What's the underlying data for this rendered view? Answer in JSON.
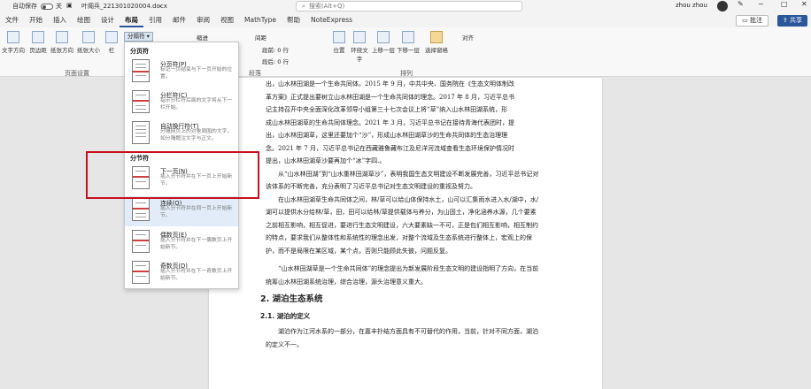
{
  "titlebar": {
    "autosave_label": "自动保存",
    "autosave_state": "关",
    "filename": "叶阁兵_221301020004.docx",
    "search_placeholder": "搜索(Alt+Q)",
    "user": "zhou zhou"
  },
  "menubar": {
    "items": [
      "文件",
      "开始",
      "插入",
      "绘图",
      "设计",
      "布局",
      "引用",
      "邮件",
      "审阅",
      "视图",
      "MathType",
      "帮助",
      "NoteExpress"
    ],
    "active": "布局",
    "comment_label": "批注",
    "share_label": "共享"
  },
  "ribbon": {
    "buttons": [
      "文字方向",
      "页边距",
      "纸张方向",
      "纸张大小",
      "栏"
    ],
    "breaks_button": "分隔符",
    "indent_label": "缩进",
    "spacing_label": "间距",
    "spacing_before": "段前: 0 行",
    "spacing_after": "段后: 0 行",
    "page_setup_label": "页面设置",
    "paragraph_label": "段落",
    "arrange_label": "排列",
    "arrange_buttons": [
      "位置",
      "环绕文字",
      "上移一层",
      "下移一层",
      "选择窗格"
    ],
    "align_label": "对齐"
  },
  "dropdown": {
    "section_page": "分页符",
    "section_section": "分节符",
    "items": [
      {
        "title": "分页符(P)",
        "desc": "标记一页结束与下一页开始的位置。"
      },
      {
        "title": "分栏符(C)",
        "desc": "指示分栏符后面的文字将从下一栏开始。"
      },
      {
        "title": "自动换行符(T)",
        "desc": "分隔网页上的对象周围的文字，如分隔题注文字与正文。"
      },
      {
        "title": "下一页(N)",
        "desc": "插入分节符并在下一页上开始新节。"
      },
      {
        "title": "连续(O)",
        "desc": "插入分节符并在同一页上开始新节。"
      },
      {
        "title": "偶数页(E)",
        "desc": "插入分节符并在下一偶数页上开始新节。"
      },
      {
        "title": "奇数页(D)",
        "desc": "插入分节符并在下一奇数页上开始新节。"
      }
    ]
  },
  "document": {
    "paragraphs": [
      "出，山水林田湖是一个生命共同体。2015 年 9 月，中共中央、国务院在《生态文明体制改",
      "革方案》正式提出要树立山水林田湖是一个生命共同体的理念。2017 年 8 月，习近平总书",
      "记主持召开中央全面深化改革领导小组第三十七次会议上将“草”纳入山水林田湖系统，形",
      "成山水林田湖草的生命共同体理念。2021 年 3 月，习近平总书记在接待青海代表团时，提",
      "出，山水林田湖草，这里还要加个“沙”，形成山水林田湖草沙的生命共同体的生态治理理",
      "念。2021 年 7 月，习近平总书记在西藏雅鲁藏布江及尼洋河流域查看生态环境保护情况时",
      "提出，山水林田湖草沙要再加个“冰”字四.。"
    ],
    "para2": "从“山水林田湖”到“山水重林田湖草沙”，表明我国生态文明建设不断发展完善，习近平总书记对该体系的不断完善，充分表明了习近平总书记对生态文明建设的重视及努力。",
    "para3": "在山水林田湖草生命共同体之间，林/草可以给山体保持水土，山可以汇集雨水进入水/湖中，水/湖可以提供水分给林/草，田，田可以给林/草提供载体与养分，为山固土，净化涵养水源，几个要素之前相互影响，相互促进，要进行生态文明建设，六大要素缺一不可，正是包们相互影响，相互制约的特点，要求我们从整体性和系统性的理念出发，对整个流域及生态系统进行整体上，宏观上的保护，而不是局限在某区域，某个点，否则只能顾此失彼，问题反复。",
    "para4": "“山水林田湖草是一个生命共同体”的理念提出为新发展阶段生态文明的建设指明了方向，在当前统筹山水林田湖系统治理，综合治理，源头治理意义重大。",
    "h2": "2. 湖泊生态系统",
    "h3": "2.1. 湖泊的定义",
    "para5": "湖泊作为江河水系的一部分，在嘉丰扑结方面具有不可替代的作用，当前，针对不同方面，湖泊的定义不一。"
  }
}
